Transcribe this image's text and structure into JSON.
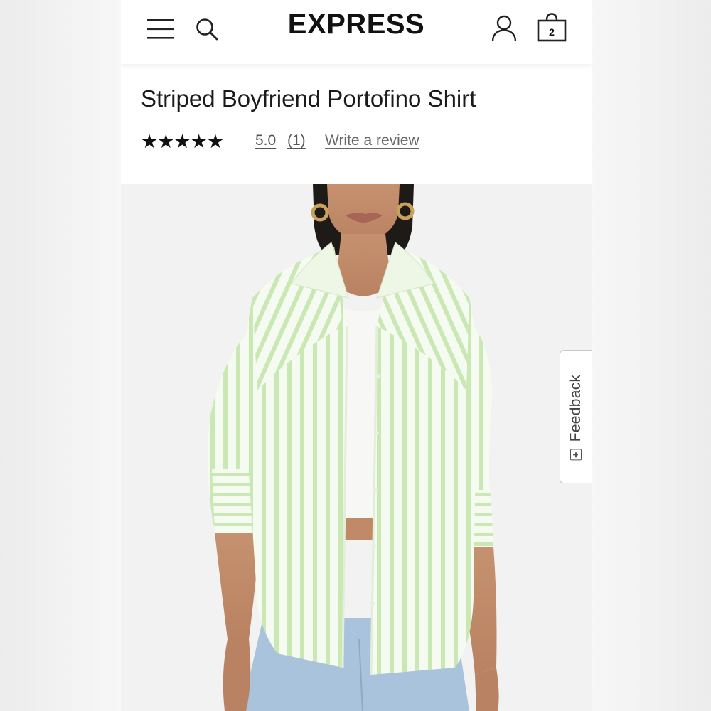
{
  "header": {
    "brand": "EXPRESS",
    "bag_count": "2",
    "icons": {
      "menu": "hamburger-menu-icon",
      "search": "search-icon",
      "account": "user-icon",
      "bag": "shopping-bag-icon"
    }
  },
  "product": {
    "title": "Striped Boyfriend Portofino Shirt",
    "stars": "★★★★★",
    "rating": "5.0",
    "review_count": "(1)",
    "write_review": "Write a review",
    "stripe_color": "#c9e8b4"
  },
  "feedback": {
    "label": "Feedback"
  }
}
